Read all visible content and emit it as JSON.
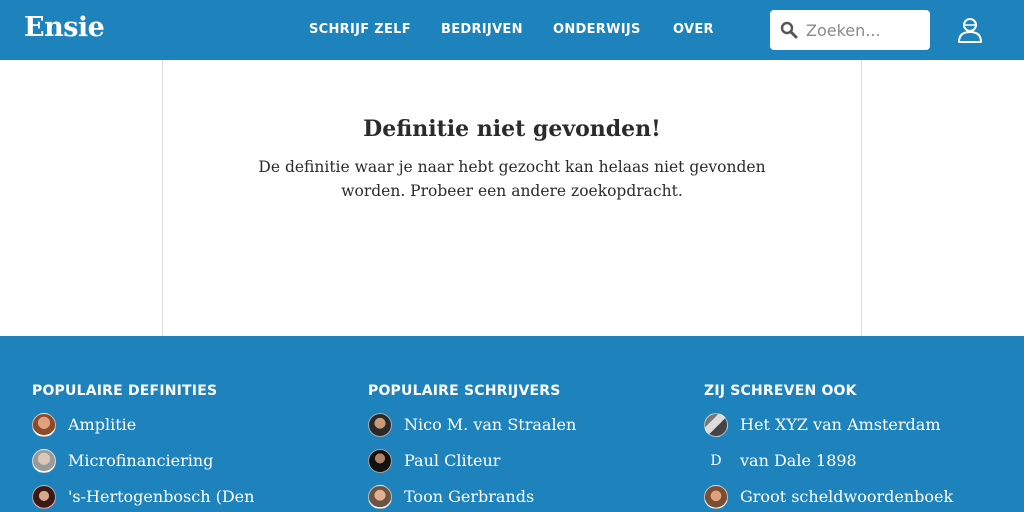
{
  "header": {
    "logo": "Ensie",
    "nav": [
      {
        "label": "SCHRIJF ZELF"
      },
      {
        "label": "BEDRIJVEN"
      },
      {
        "label": "ONDERWIJS"
      },
      {
        "label": "OVER"
      }
    ],
    "search": {
      "placeholder": "Zoeken...",
      "value": ""
    },
    "icons": {
      "search": "search-icon",
      "user": "user-icon"
    },
    "colors": {
      "brand": "#1e82bd"
    }
  },
  "main": {
    "title": "Definitie niet gevonden!",
    "message": "De definitie waar je naar hebt gezocht kan helaas niet gevonden worden. Probeer een andere zoekopdracht."
  },
  "footer": {
    "columns": [
      {
        "heading": "POPULAIRE DEFINITIES",
        "items": [
          {
            "label": "Amplitie",
            "avatar": "photo-avatar"
          },
          {
            "label": "Microfinanciering",
            "avatar": "photo-avatar"
          },
          {
            "label": "'s-Hertogenbosch (Den",
            "avatar": "photo-avatar"
          }
        ]
      },
      {
        "heading": "POPULAIRE SCHRIJVERS",
        "items": [
          {
            "label": "Nico M. van Straalen",
            "avatar": "photo-avatar"
          },
          {
            "label": "Paul Cliteur",
            "avatar": "photo-avatar"
          },
          {
            "label": "Toon Gerbrands",
            "avatar": "photo-avatar"
          }
        ]
      },
      {
        "heading": "ZIJ SCHREVEN OOK",
        "items": [
          {
            "label": "Het XYZ van Amsterdam",
            "avatar": "photo-avatar"
          },
          {
            "label": "van Dale 1898",
            "avatar": "letter-avatar",
            "letter": "D"
          },
          {
            "label": "Groot scheldwoordenboek",
            "avatar": "photo-avatar"
          }
        ]
      }
    ]
  }
}
